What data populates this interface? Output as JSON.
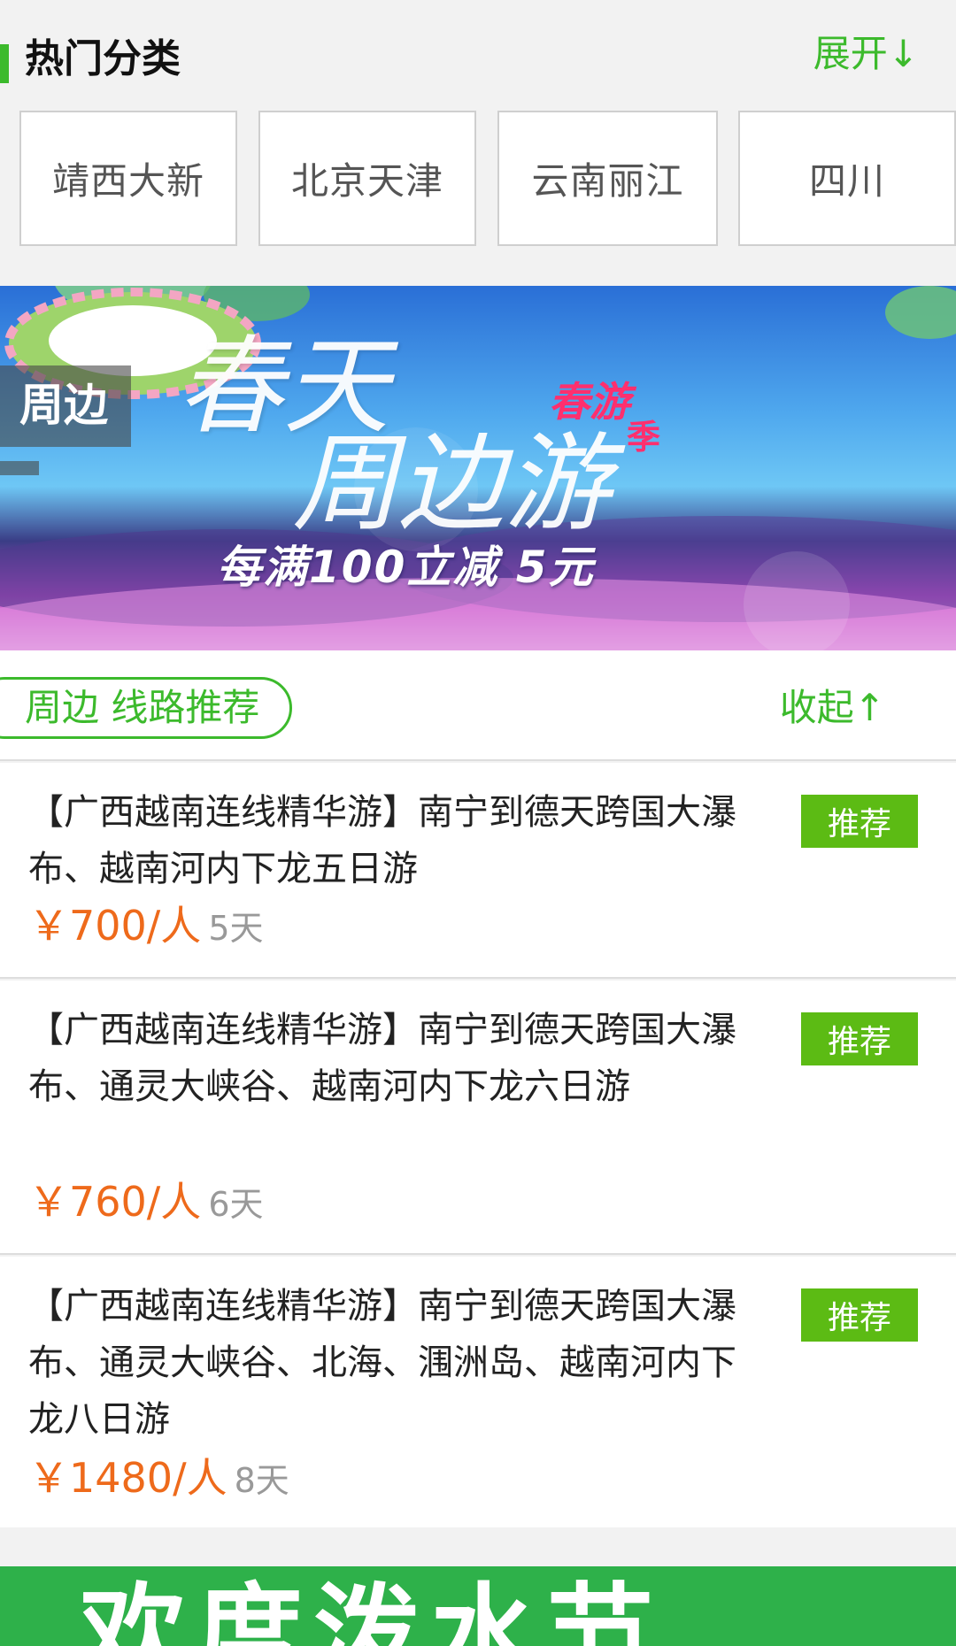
{
  "hot_categories": {
    "title": "热门分类",
    "expand_label": "展开↓",
    "items": [
      "靖西大新",
      "北京天津",
      "云南丽江",
      "四川"
    ]
  },
  "banner": {
    "tag": "周边",
    "calligraphy_line1": "春天",
    "calligraphy_line2": "周边游",
    "badge_line1": "春游",
    "badge_line2": "季",
    "promo": "每满100立减 5元"
  },
  "recommend": {
    "pill_label": "周边 线路推荐",
    "collapse_label": "收起↑",
    "routes": [
      {
        "title": "【广西越南连线精华游】南宁到德天跨国大瀑布、越南河内下龙五日游",
        "price": "￥700/人",
        "days": "5天",
        "tag": "推荐"
      },
      {
        "title": "【广西越南连线精华游】南宁到德天跨国大瀑布、通灵大峡谷、越南河内下龙六日游",
        "price": "￥760/人",
        "days": "6天",
        "tag": "推荐"
      },
      {
        "title": "【广西越南连线精华游】南宁到德天跨国大瀑布、通灵大峡谷、北海、涠洲岛、越南河内下龙八日游",
        "price": "￥1480/人",
        "days": "8天",
        "tag": "推荐"
      }
    ]
  },
  "bottom_banner": {
    "text": "欢度泼水节"
  },
  "colors": {
    "accent_green": "#3cba2c",
    "tag_green": "#5cbb14",
    "price_orange": "#ee6a1b"
  }
}
